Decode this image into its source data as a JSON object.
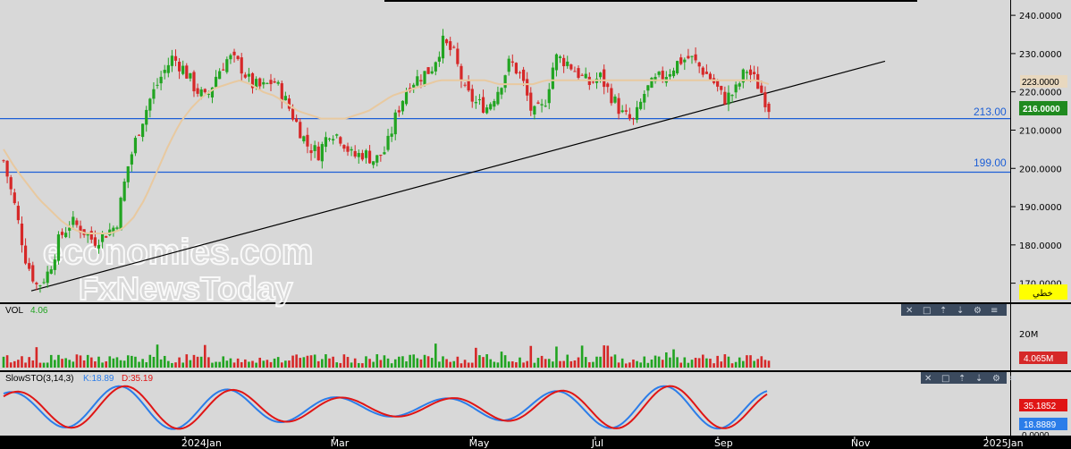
{
  "chart_data": [
    {
      "type": "candlestick",
      "title": "",
      "y_ticks": [
        "240.0000",
        "230.0000",
        "220.0000",
        "210.0000",
        "200.0000",
        "190.0000",
        "180.0000",
        "170.0000"
      ],
      "ylim": [
        165,
        244
      ],
      "x_ticks": [
        "2024Jan",
        "Mar",
        "May",
        "Jul",
        "Sep",
        "Nov",
        "2025Jan"
      ],
      "last_price": "216.0000",
      "ma_price": "223.0000",
      "hlines": [
        {
          "label": "213.00",
          "value": 213
        },
        {
          "label": "199.00",
          "value": 199
        }
      ],
      "trendline": {
        "from": [
          0,
          168
        ],
        "to": [
          1,
          228
        ]
      },
      "close_path": [
        202,
        190,
        176,
        169,
        173,
        182,
        186,
        184,
        181,
        183,
        185,
        200,
        210,
        218,
        224,
        229,
        226,
        221,
        218,
        225,
        229,
        227,
        222,
        221,
        223,
        218,
        212,
        206,
        204,
        210,
        208,
        203,
        204,
        202,
        205,
        215,
        222,
        224,
        226,
        233,
        230,
        220,
        217,
        216,
        221,
        228,
        224,
        214,
        216,
        229,
        228,
        225,
        222,
        224,
        219,
        214,
        212,
        220,
        223,
        225,
        228,
        229,
        226,
        223,
        218,
        220,
        226,
        222,
        216
      ],
      "ma_path": [
        205,
        200,
        196,
        192,
        189,
        186,
        184,
        183,
        183,
        183,
        184,
        187,
        192,
        199,
        206,
        212,
        216,
        219,
        221,
        222,
        223,
        222,
        220,
        219,
        217,
        215,
        214,
        213,
        213,
        213,
        214,
        215,
        217,
        219,
        220,
        221,
        222,
        223,
        223,
        223,
        223,
        223,
        222,
        222,
        222,
        222,
        223,
        223,
        223,
        223,
        223,
        223,
        223,
        223,
        223,
        223,
        223,
        223,
        223,
        223,
        223,
        223,
        223,
        223,
        223,
        222
      ]
    },
    {
      "type": "bar",
      "title": "VOL",
      "value_label": "4.06",
      "y_tick": "20M",
      "last_value": "4.065M"
    },
    {
      "type": "line",
      "title": "SlowSTO(3,14,3)",
      "k_label": "K:18.89",
      "d_label": "D:35.19",
      "k_value": "18.8889",
      "d_value": "35.1852",
      "min_label": "0.0000",
      "ylim": [
        0,
        100
      ]
    }
  ],
  "price_tag_label": "خطي",
  "watermark": {
    "line1": "economies.com",
    "line2": "FxNewsToday"
  },
  "colors": {
    "bg": "#d8d8d8",
    "axis_bg": "#d8d8d8",
    "up": "#21a421",
    "down": "#d62828",
    "ma": "#e8c9a0",
    "hline": "#1d5fd6",
    "k": "#2b7de9",
    "d": "#e01515"
  },
  "toolbar_icons": [
    "close-icon",
    "square-icon",
    "up-arrow-icon",
    "down-arrow-icon",
    "settings-icon",
    "menu-icon"
  ]
}
